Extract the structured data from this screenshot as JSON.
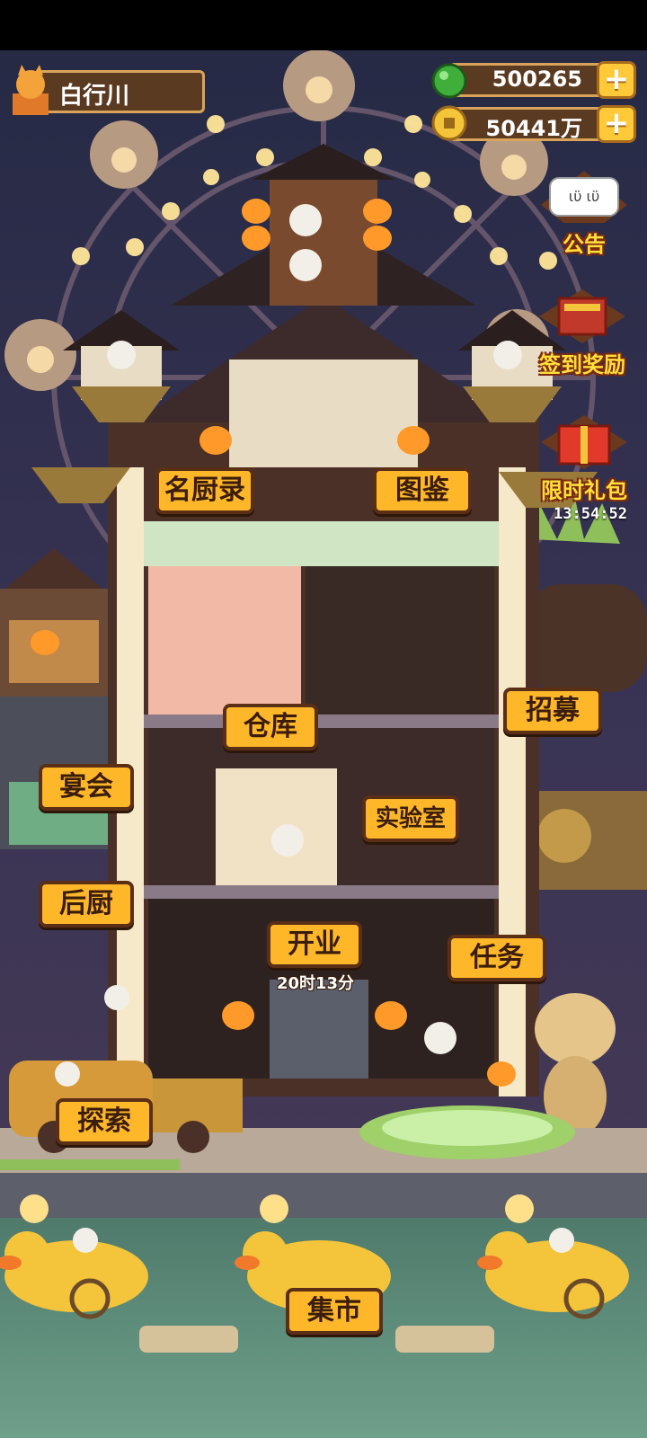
{
  "player": {
    "name": "白行川"
  },
  "resources": {
    "gems": "500265",
    "coins": "50441万"
  },
  "side_menu": {
    "notice": "公告",
    "notice_bubble": "ιϋ ιϋ",
    "signin": "签到奖励",
    "gift": "限时礼包",
    "gift_timer": "13:54:52"
  },
  "signs": {
    "chefs": "名厨录",
    "gallery": "图鉴",
    "warehouse": "仓库",
    "recruit": "招募",
    "banquet": "宴会",
    "lab": "实验室",
    "kitchen": "后厨",
    "open": "开业",
    "open_timer": "20时13分",
    "tasks": "任务",
    "explore": "探索",
    "market": "集市"
  },
  "colors": {
    "sign_fill": "#ffb72a",
    "sign_border": "#5a2f16",
    "hud_plate": "#5b3a22",
    "plus_button": "#ffc93a",
    "sky": "#1c1f33",
    "water": "#5f8f7c"
  },
  "icons": [
    "cat-avatar-icon",
    "green-gem-icon",
    "gold-coin-icon",
    "plus-icon",
    "notice-board-icon",
    "signin-chest-icon",
    "gift-box-icon"
  ]
}
